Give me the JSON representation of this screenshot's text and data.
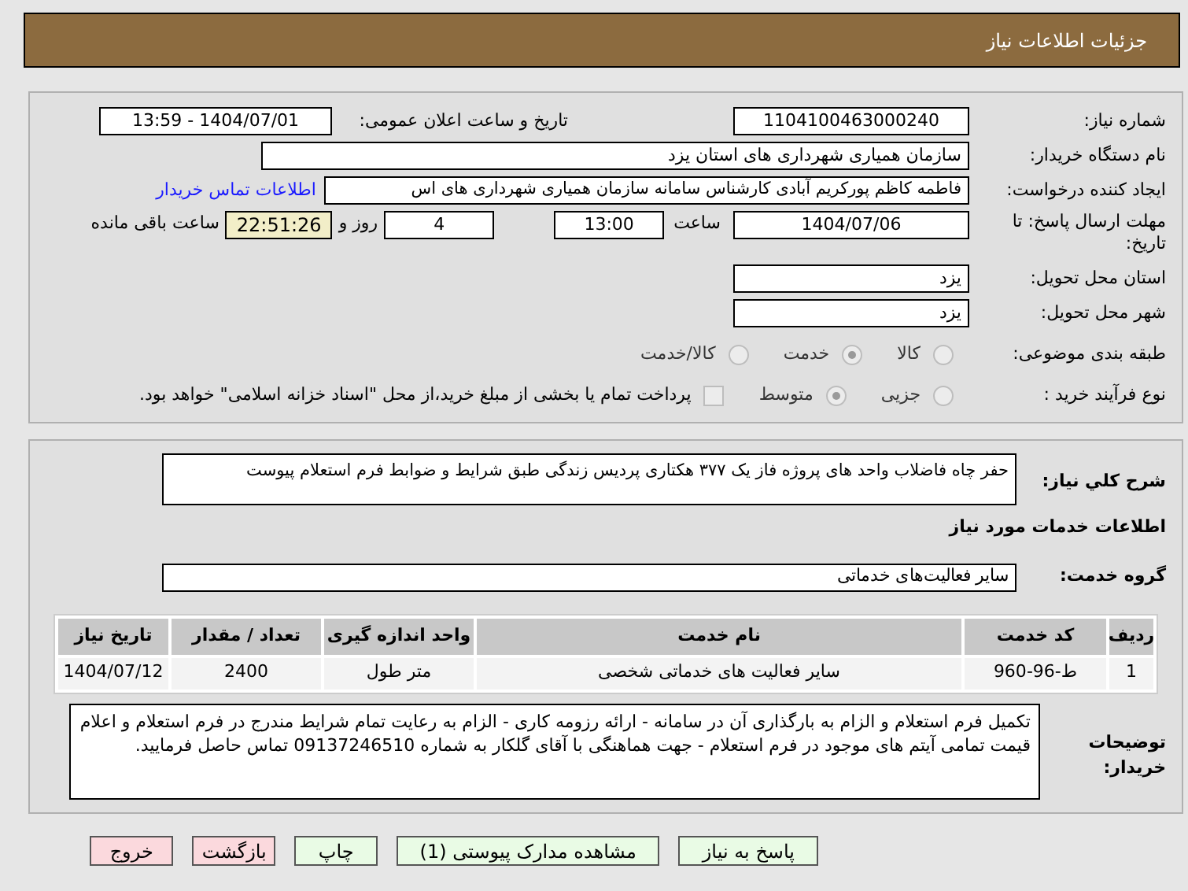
{
  "header": {
    "title": "جزئیات اطلاعات نیاز"
  },
  "info": {
    "need_number_label": "شماره نیاز:",
    "need_number": "1104100463000240",
    "announce_label": "تاریخ و ساعت اعلان عمومی:",
    "announce": "1404/07/01 - 13:59",
    "buyer_label": "نام دستگاه خریدار:",
    "buyer": "سازمان همیاری شهرداری های استان یزد",
    "requester_label": "ایجاد کننده درخواست:",
    "requester": "فاطمه کاظم پورکریم آبادی کارشناس سامانه سازمان همیاری شهرداری های اس",
    "contact_link": "اطلاعات تماس خریدار",
    "deadline_label": "مهلت ارسال پاسخ: تا تاریخ:",
    "deadline_date": "1404/07/06",
    "time_label": "ساعت",
    "deadline_time": "13:00",
    "days": "4",
    "days_label": "روز و",
    "remaining": "22:51:26",
    "remaining_label": "ساعت باقی مانده",
    "province_label": "استان محل تحویل:",
    "province": "یزد",
    "city_label": "شهر محل تحویل:",
    "city": "یزد",
    "category_label": "طبقه بندی موضوعی:",
    "category_options": [
      {
        "label": "کالا",
        "selected": false
      },
      {
        "label": "خدمت",
        "selected": true
      },
      {
        "label": "کالا/خدمت",
        "selected": false
      }
    ],
    "process_label": "نوع فرآیند خرید :",
    "process_options": [
      {
        "label": "جزیی",
        "selected": false
      },
      {
        "label": "متوسط",
        "selected": true
      }
    ],
    "payment": {
      "checked": false,
      "label": "پرداخت تمام یا بخشی از مبلغ خرید،از محل \"اسناد خزانه اسلامی\" خواهد بود."
    }
  },
  "details": {
    "description_label": "شرح کلي نياز:",
    "description": "حفر چاه فاضلاب واحد های پروژه فاز یک ۳۷۷ هکتاری پردیس زندگی طبق شرایط و ضوابط فرم استعلام پیوست",
    "services_title": "اطلاعات خدمات مورد نیاز",
    "group_label": "گروه خدمت:",
    "group": "سایر فعالیت‌های خدماتی",
    "table": {
      "columns": [
        "ردیف",
        "کد خدمت",
        "نام خدمت",
        "واحد اندازه گیری",
        "تعداد / مقدار",
        "تاریخ نیاز"
      ],
      "rows": [
        [
          "1",
          "ط-96-960",
          "سایر فعالیت های خدماتی شخصی",
          "متر طول",
          "2400",
          "1404/07/12"
        ]
      ]
    },
    "notes_label": "توضیحات خریدار:",
    "notes": "تکمیل فرم استعلام و الزام به بارگذاری آن در سامانه - ارائه رزومه کاری - الزام به رعایت تمام شرایط مندرج در فرم استعلام و اعلام قیمت تمامی آیتم های موجود در فرم استعلام - جهت هماهنگی با آقای گلکار به شماره 09137246510 تماس حاصل فرمایید."
  },
  "buttons": [
    {
      "label": "پاسخ به نیاز",
      "kind": "action"
    },
    {
      "label": "مشاهده مدارک پیوستی (1)",
      "kind": "action"
    },
    {
      "label": "چاپ",
      "kind": "action"
    },
    {
      "label": "بازگشت",
      "kind": "back"
    },
    {
      "label": "خروج",
      "kind": "exit"
    }
  ]
}
